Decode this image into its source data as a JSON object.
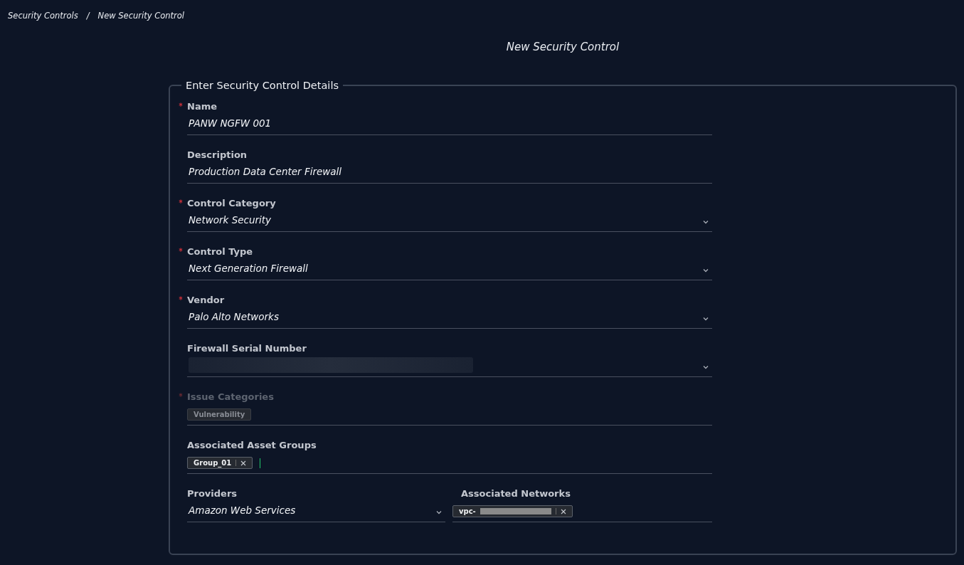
{
  "breadcrumb": [
    {
      "label": "Security Controls"
    },
    {
      "label": "New Security Control"
    }
  ],
  "breadcrumb_separator": "/",
  "page_title": "New Security Control",
  "form": {
    "legend": "Enter Security Control Details",
    "rows": [
      {
        "fields": [
          {
            "kind": "text",
            "label": "Name",
            "required": true,
            "disabled": false,
            "value": "PANW NGFW 001"
          }
        ]
      },
      {
        "fields": [
          {
            "kind": "text",
            "label": "Description",
            "required": false,
            "disabled": false,
            "value": "Production Data Center Firewall"
          }
        ]
      },
      {
        "fields": [
          {
            "kind": "select",
            "label": "Control Category",
            "required": true,
            "disabled": false,
            "value": "Network Security"
          }
        ]
      },
      {
        "fields": [
          {
            "kind": "select",
            "label": "Control Type",
            "required": true,
            "disabled": false,
            "value": "Next Generation Firewall"
          }
        ]
      },
      {
        "fields": [
          {
            "kind": "select",
            "label": "Vendor",
            "required": true,
            "disabled": false,
            "value": "Palo Alto Networks"
          }
        ]
      },
      {
        "fields": [
          {
            "kind": "select",
            "label": "Firewall Serial Number",
            "required": false,
            "disabled": false,
            "redacted": true
          }
        ]
      },
      {
        "fields": [
          {
            "kind": "tags",
            "label": "Issue Categories",
            "required": true,
            "disabled": true,
            "focused": false,
            "tags": [
              {
                "label": "Vulnerability",
                "removable": false,
                "redacted": false
              }
            ]
          }
        ]
      },
      {
        "fields": [
          {
            "kind": "tags",
            "label": "Associated Asset Groups",
            "required": false,
            "disabled": false,
            "focused": true,
            "tags": [
              {
                "label": "Group_01",
                "removable": true,
                "redacted": false
              }
            ]
          }
        ]
      },
      {
        "fields": [
          {
            "kind": "select",
            "label": "Providers",
            "required": false,
            "disabled": false,
            "value": "Amazon Web Services"
          },
          {
            "kind": "tags",
            "label": "Associated Networks",
            "required": false,
            "disabled": false,
            "focused": false,
            "tags": [
              {
                "label": "vpc-",
                "removable": true,
                "redacted": true
              }
            ]
          }
        ]
      }
    ]
  }
}
